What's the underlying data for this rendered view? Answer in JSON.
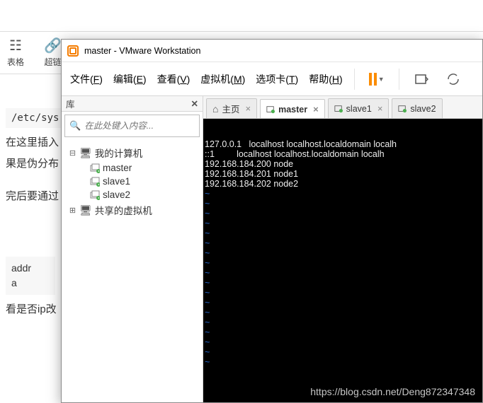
{
  "bg": {
    "tool_table": "表格",
    "tool_super": "超链",
    "code1": "/etc/sys",
    "line1": "在这里插入",
    "line2": "果是伪分布",
    "line3": "完后要通过",
    "code2a": "addr",
    "code2b": "a",
    "line4": "看是否ip改"
  },
  "window_title": "master - VMware Workstation",
  "menu": {
    "file": "文件",
    "file_u": "F",
    "edit": "编辑",
    "edit_u": "E",
    "view": "查看",
    "view_u": "V",
    "vm": "虚拟机",
    "vm_u": "M",
    "tabs": "选项卡",
    "tabs_u": "T",
    "help": "帮助",
    "help_u": "H"
  },
  "lib": {
    "title": "库",
    "search_placeholder": "在此处键入内容...",
    "root": "我的计算机",
    "items": [
      "master",
      "slave1",
      "slave2"
    ],
    "shared": "共享的虚拟机"
  },
  "tabs": {
    "home": "主页",
    "t1": "master",
    "t2": "slave1",
    "t3": "slave2",
    "active": "master"
  },
  "terminal": {
    "lines": [
      "127.0.0.1   localhost localhost.localdomain localh",
      "::1         localhost localhost.localdomain localh",
      "192.168.184.200 node",
      "192.168.184.201 node1",
      "192.168.184.202 node2"
    ],
    "tilde_count": 18
  },
  "watermark": "https://blog.csdn.net/Deng872347348"
}
